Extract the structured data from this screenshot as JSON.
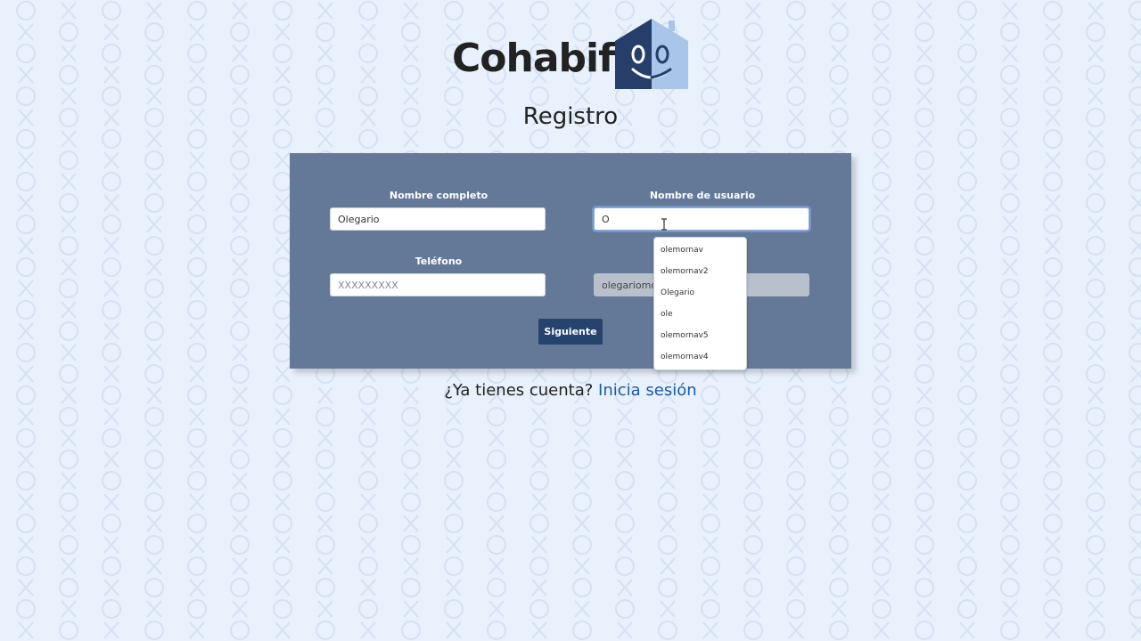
{
  "brand": {
    "name": "Cohabify"
  },
  "page": {
    "title": "Registro"
  },
  "form": {
    "full_name": {
      "label": "Nombre completo",
      "value": "Olegario"
    },
    "username": {
      "label": "Nombre de usuario",
      "value": "O"
    },
    "phone": {
      "label": "Teléfono",
      "placeholder": "XXXXXXXXX"
    },
    "email": {
      "value": "olegariomor"
    },
    "next_button": "Siguiente"
  },
  "autocomplete": {
    "items": [
      "olemornav",
      "olemornav2",
      "Olegario",
      "ole",
      "olemornav5",
      "olemornav4"
    ]
  },
  "login_prompt": {
    "question": "¿Ya tienes cuenta?",
    "link": "Inicia sesión"
  },
  "colors": {
    "background": "#e9f1fc",
    "card": "#647898",
    "button": "#26436e",
    "link": "#1d59a8",
    "house_dark": "#253f6a",
    "house_light": "#a9c5ea"
  },
  "icons": {
    "logo": "smiling-house-icon",
    "cursor": "text-cursor-icon",
    "pattern": "tic-tac-toe-pattern"
  }
}
